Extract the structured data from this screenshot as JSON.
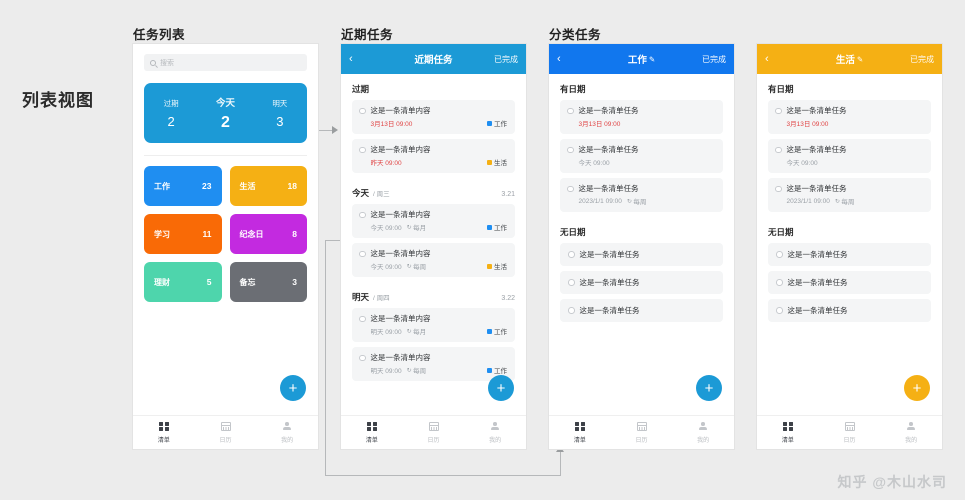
{
  "page": {
    "view_label": "列表视图",
    "watermark": "知乎 @木山水司",
    "bg_color": "#ececec"
  },
  "captions": {
    "phone1": "任务列表",
    "phone2": "近期任务",
    "phone3": "分类任务"
  },
  "colors": {
    "summary_blue": "#1c9ad6",
    "header_blue": "#1c9ad6",
    "work_blue": "#1f8ef1",
    "life_yellow": "#f5b014",
    "study_orange": "#f96a06",
    "anniversary_purple": "#c32ae0",
    "finance_green": "#4ed5ac",
    "memo_gray": "#6b6e74",
    "overdue_red": "#e04444",
    "fab_blue": "#1c9ad6",
    "fab_yellow": "#f5b014"
  },
  "phone1": {
    "search": {
      "placeholder": "搜索",
      "value": "",
      "icon": "search-icon"
    },
    "summary": [
      {
        "label": "过期",
        "count": "2",
        "active": false
      },
      {
        "label": "今天",
        "count": "2",
        "active": true
      },
      {
        "label": "明天",
        "count": "3",
        "active": false
      }
    ],
    "tiles": [
      {
        "name": "工作",
        "count": "23",
        "color": "#1f8ef1"
      },
      {
        "name": "生活",
        "count": "18",
        "color": "#f5b014"
      },
      {
        "name": "学习",
        "count": "11",
        "color": "#f96a06"
      },
      {
        "name": "纪念日",
        "count": "8",
        "color": "#c32ae0"
      },
      {
        "name": "理财",
        "count": "5",
        "color": "#4ed5ac"
      },
      {
        "name": "备忘",
        "count": "3",
        "color": "#6b6e74"
      }
    ],
    "fab": "+",
    "tabs": [
      {
        "label": "清单",
        "icon": "grid-icon",
        "active": true
      },
      {
        "label": "日历",
        "icon": "calendar-icon",
        "active": false
      },
      {
        "label": "我的",
        "icon": "user-icon",
        "active": false
      }
    ]
  },
  "phone2": {
    "header": {
      "back": "‹",
      "title": "近期任务",
      "done": "已完成",
      "bg": "#1c9ad6"
    },
    "groups": [
      {
        "title": "过期",
        "sub": "",
        "date": "",
        "tasks": [
          {
            "text": "这是一条清单内容",
            "time": "3月13日  09:00",
            "repeat": "",
            "overdue": true,
            "tag": "工作",
            "tag_color": "#1f8ef1"
          },
          {
            "text": "这是一条清单内容",
            "time": "昨天  09:00",
            "repeat": "",
            "overdue": true,
            "tag": "生活",
            "tag_color": "#f5b014"
          }
        ]
      },
      {
        "title": "今天",
        "sub": "/ 周三",
        "date": "3.21",
        "tasks": [
          {
            "text": "这是一条清单内容",
            "time": "今天  09:00",
            "repeat": "每月",
            "overdue": false,
            "tag": "工作",
            "tag_color": "#1f8ef1"
          },
          {
            "text": "这是一条清单内容",
            "time": "今天  09:00",
            "repeat": "每周",
            "overdue": false,
            "tag": "生活",
            "tag_color": "#f5b014"
          }
        ]
      },
      {
        "title": "明天",
        "sub": "/ 周四",
        "date": "3.22",
        "tasks": [
          {
            "text": "这是一条清单内容",
            "time": "明天  09:00",
            "repeat": "每月",
            "overdue": false,
            "tag": "工作",
            "tag_color": "#1f8ef1"
          },
          {
            "text": "这是一条清单内容",
            "time": "明天  09:00",
            "repeat": "每周",
            "overdue": false,
            "tag": "工作",
            "tag_color": "#1f8ef1"
          }
        ]
      }
    ],
    "fab": "+",
    "tabs": [
      {
        "label": "清单",
        "icon": "grid-icon",
        "active": true
      },
      {
        "label": "日历",
        "icon": "calendar-icon",
        "active": false
      },
      {
        "label": "我的",
        "icon": "user-icon",
        "active": false
      }
    ]
  },
  "phone3": {
    "header": {
      "back": "‹",
      "title": "工作",
      "pencil": "✎",
      "done": "已完成",
      "bg": "#1177ee"
    },
    "groups": [
      {
        "title": "有日期",
        "tasks": [
          {
            "text": "这是一条清单任务",
            "time": "3月13日  09:00",
            "repeat": "",
            "overdue": true
          },
          {
            "text": "这是一条清单任务",
            "time": "今天  09:00",
            "repeat": "",
            "overdue": false
          },
          {
            "text": "这是一条清单任务",
            "time": "2023/1/1  09:00",
            "repeat": "每周",
            "overdue": false
          }
        ]
      },
      {
        "title": "无日期",
        "tasks": [
          {
            "text": "这是一条清单任务"
          },
          {
            "text": "这是一条清单任务"
          },
          {
            "text": "这是一条清单任务"
          }
        ]
      }
    ],
    "fab": "+",
    "tabs": [
      {
        "label": "清单",
        "icon": "grid-icon",
        "active": true
      },
      {
        "label": "日历",
        "icon": "calendar-icon",
        "active": false
      },
      {
        "label": "我的",
        "icon": "user-icon",
        "active": false
      }
    ]
  },
  "phone4": {
    "header": {
      "back": "‹",
      "title": "生活",
      "pencil": "✎",
      "done": "已完成",
      "bg": "#f5b014"
    },
    "groups": [
      {
        "title": "有日期",
        "tasks": [
          {
            "text": "这是一条清单任务",
            "time": "3月13日  09:00",
            "repeat": "",
            "overdue": true
          },
          {
            "text": "这是一条清单任务",
            "time": "今天  09:00",
            "repeat": "",
            "overdue": false
          },
          {
            "text": "这是一条清单任务",
            "time": "2023/1/1  09:00",
            "repeat": "每周",
            "overdue": false
          }
        ]
      },
      {
        "title": "无日期",
        "tasks": [
          {
            "text": "这是一条清单任务"
          },
          {
            "text": "这是一条清单任务"
          },
          {
            "text": "这是一条清单任务"
          }
        ]
      }
    ],
    "fab": "+",
    "tabs": [
      {
        "label": "清单",
        "icon": "grid-icon",
        "active": true
      },
      {
        "label": "日历",
        "icon": "calendar-icon",
        "active": false
      },
      {
        "label": "我的",
        "icon": "user-icon",
        "active": false
      }
    ]
  }
}
